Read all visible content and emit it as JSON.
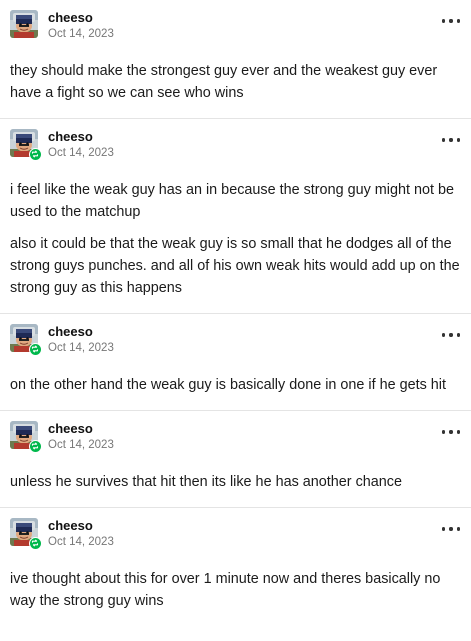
{
  "thread": {
    "posts": [
      {
        "username": "cheeso",
        "date": "Oct 14, 2023",
        "is_reblog": false,
        "paragraphs": [
          "they should make the strongest guy ever and the weakest guy ever have a fight so we can see who wins"
        ]
      },
      {
        "username": "cheeso",
        "date": "Oct 14, 2023",
        "is_reblog": true,
        "paragraphs": [
          "i feel like the weak guy has an in because the strong guy might not be used to the matchup",
          "also it could be that the weak guy is so small that he dodges all of the strong guys punches. and all of his own weak hits would add up on the strong guy as this happens"
        ]
      },
      {
        "username": "cheeso",
        "date": "Oct 14, 2023",
        "is_reblog": true,
        "paragraphs": [
          "on the other hand the weak guy is basically done in one if he gets hit"
        ]
      },
      {
        "username": "cheeso",
        "date": "Oct 14, 2023",
        "is_reblog": true,
        "paragraphs": [
          "unless he survives that hit then its like he has another chance"
        ]
      },
      {
        "username": "cheeso",
        "date": "Oct 14, 2023",
        "is_reblog": true,
        "paragraphs": [
          "ive thought about this for over 1 minute now and theres basically no way the strong guy wins"
        ]
      }
    ]
  },
  "icons": {
    "more": "more-options-icon",
    "avatar": "avatar-image",
    "reblog_badge": "reblog-icon"
  },
  "colors": {
    "reblog_badge": "#00b84c",
    "divider": "#e4e4e4",
    "timestamp": "#777777",
    "body_text": "#1b1b1b"
  }
}
